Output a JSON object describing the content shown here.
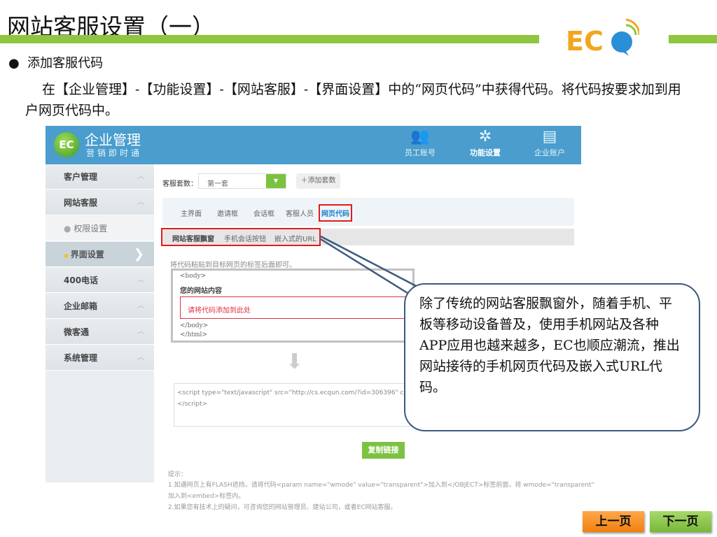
{
  "slide": {
    "title": "网站客服设置（一）",
    "bullet": "添加客服代码",
    "paragraph": "在【企业管理】-【功能设置】-【网站客服】-【界面设置】中的“网页代码”中获得代码。将代码按要求加到用户网页代码中。",
    "logo_text": "ECO",
    "callout": "除了传统的网站客服飘窗外，随着手机、平板等移动设备普及，使用手机网站及各种APP应用也越来越多，EC也顺应潮流，推出网站接待的手机网页代码及嵌入式URL代码。",
    "prev": "上一页",
    "next": "下一页"
  },
  "app": {
    "logo": "EC",
    "brand": "企业管理",
    "slogan": "营销即时通",
    "nav": [
      {
        "label": "员工账号",
        "icon": "people-icon"
      },
      {
        "label": "功能设置",
        "icon": "gear-icon"
      },
      {
        "label": "企业账户",
        "icon": "account-icon"
      }
    ],
    "sidebar": [
      "客户管理",
      "网站客服",
      "权限设置",
      "界面设置",
      "400电话",
      "企业邮箱",
      "微客通",
      "系统管理"
    ],
    "set_label": "客服套数：",
    "set_value": "第一套",
    "add_set": "＋添加套数",
    "tabs": [
      "主界面",
      "邀请框",
      "会话框",
      "客服人员",
      "网页代码"
    ],
    "subtabs": [
      "网站客服飘窗",
      "手机会话按钮",
      "嵌入式的URL"
    ],
    "instruction": "将代码粘贴到目标网页的标签后面即可。",
    "code_body": "<body>",
    "code_content": "您的网站内容",
    "code_placeholder": "请将代码添加到此处",
    "code_end_body": "</body>",
    "code_end_html": "</html>",
    "script_line1": "<script type=\"text/javascript\" src=\"http://cs.ecqun.com/?id=306396\" charset=\"u",
    "script_line2": "</script>",
    "copy": "复制链接",
    "hint_title": "提示：",
    "hint1": "1.如遇网页上有FLASH遮挡，请将代码<param name=\"wmode\" value=\"transparent\">加入到</OBJECT>标签前面，将 wmode=\"transparent\"",
    "hint1b": "加入到<embed>标签内。",
    "hint2": "2.如果您有技术上的疑问，可咨询您的网站管理员、建站公司，或者EC网站客服。"
  }
}
